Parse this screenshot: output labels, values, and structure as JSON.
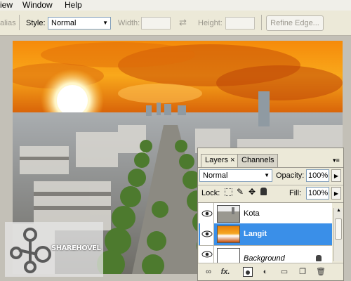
{
  "menu": {
    "items": [
      "iew",
      "Window",
      "Help"
    ]
  },
  "options": {
    "alias_label": "alias",
    "style_label": "Style:",
    "style_value": "Normal",
    "width_label": "Width:",
    "height_label": "Height:",
    "refine_edge_label": "Refine Edge..."
  },
  "watermark": {
    "text": "SHAREHOVEL"
  },
  "layers_panel": {
    "tabs": [
      {
        "label": "Layers",
        "close": "×",
        "active": true
      },
      {
        "label": "Channels",
        "active": false
      }
    ],
    "blend_mode": "Normal",
    "opacity_label": "Opacity:",
    "opacity_value": "100%",
    "lock_label": "Lock:",
    "fill_label": "Fill:",
    "fill_value": "100%",
    "layers": [
      {
        "name": "Kota",
        "visible": true,
        "selected": false
      },
      {
        "name": "Langit",
        "visible": true,
        "selected": true
      },
      {
        "name": "Background",
        "visible": true,
        "selected": false,
        "locked": true
      }
    ],
    "footer_icons": [
      "link-icon",
      "fx-icon",
      "mask-icon",
      "adjustment-icon",
      "group-icon",
      "new-layer-icon",
      "trash-icon"
    ],
    "footer_fx_label": "fx.",
    "colors": {
      "selected": "#3a8fe8"
    }
  }
}
